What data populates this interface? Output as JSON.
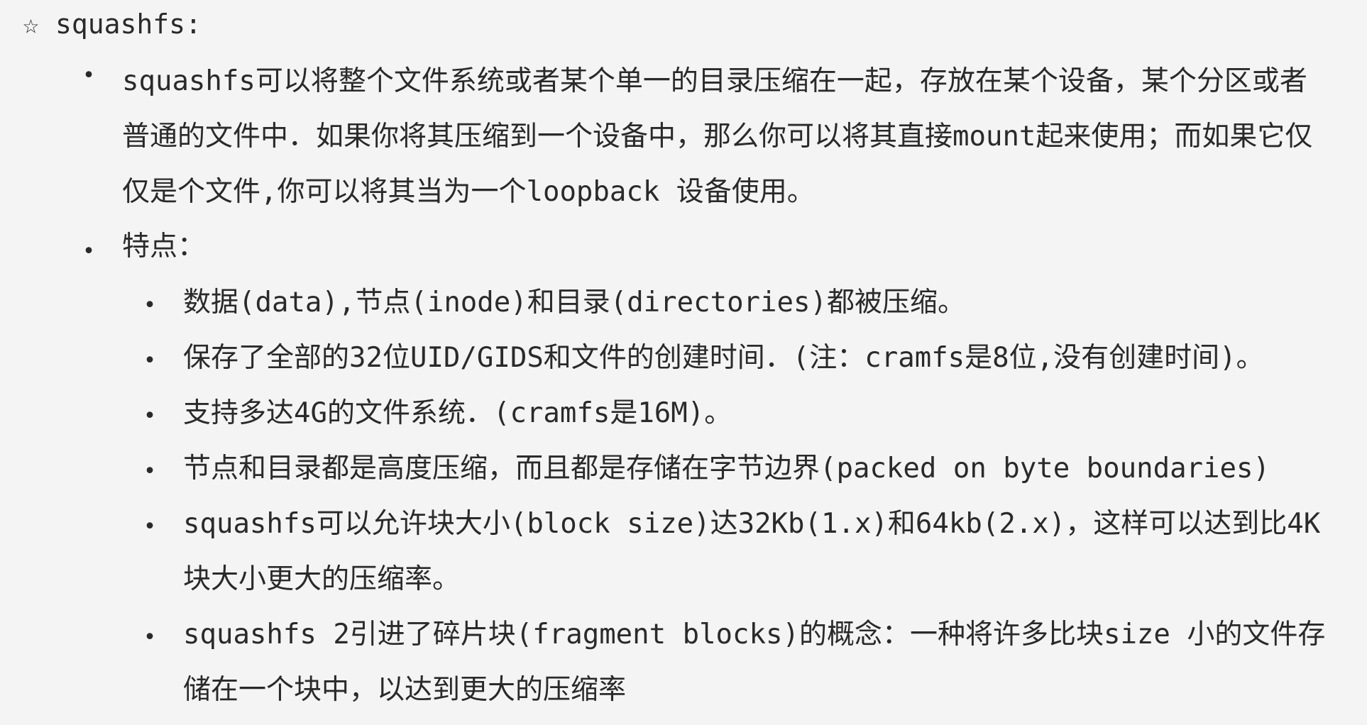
{
  "heading": {
    "star": "☆",
    "text": "squashfs:"
  },
  "bullet_char": "•",
  "intro": "squashfs可以将整个文件系统或者某个单一的目录压缩在一起，存放在某个设备，某个分区或者普通的文件中．如果你将其压缩到一个设备中，那么你可以将其直接mount起来使用；而如果它仅仅是个文件,你可以将其当为一个loopback 设备使用。",
  "features_label": "特点：",
  "features": [
    "数据(data),节点(inode)和目录(directories)都被压缩。",
    "保存了全部的32位UID/GIDS和文件的创建时间．(注：cramfs是8位,没有创建时间)。",
    "支持多达4G的文件系统．(cramfs是16M)。",
    "节点和目录都是高度压缩，而且都是存储在字节边界(packed on byte boundaries)",
    "squashfs可以允许块大小(block size)达32Kb(1.x)和64kb(2.x)，这样可以达到比4K块大小更大的压缩率。",
    "squashfs 2引进了碎片块(fragment blocks)的概念：一种将许多比块size 小的文件存储在一个块中，以达到更大的压缩率"
  ]
}
